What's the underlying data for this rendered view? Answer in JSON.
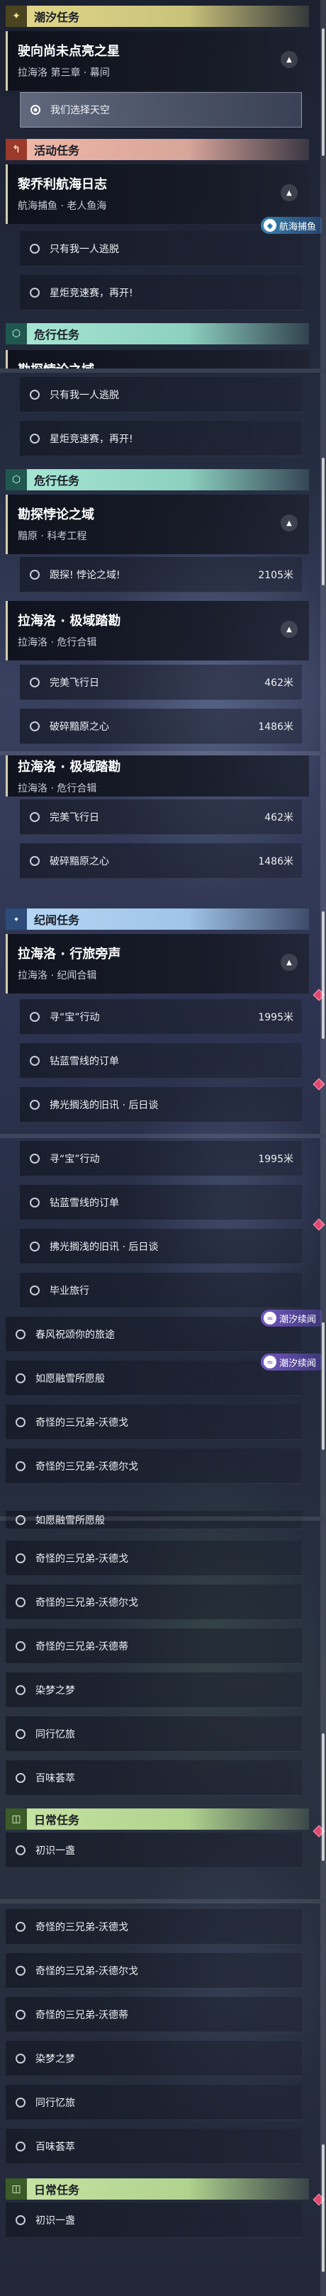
{
  "categories": {
    "sea": {
      "label": "潮汐任务",
      "icon": "✦"
    },
    "activity": {
      "label": "活动任务",
      "icon": "↰"
    },
    "danger": {
      "label": "危行任务",
      "icon": "⬡"
    },
    "record": {
      "label": "纪闻任务",
      "icon": "⬩"
    },
    "daily": {
      "label": "日常任务",
      "icon": "◫"
    }
  },
  "quests": {
    "q1": {
      "title": "驶向尚未点亮之星",
      "subtitle": "拉海洛 第三章 · 幕间"
    },
    "q2": {
      "title": "黎乔利航海日志",
      "subtitle": "航海捕鱼 · 老人鱼海"
    },
    "q3": {
      "title": "勘探悖论之域",
      "subtitle": "黯原 · 科考工程"
    },
    "q4": {
      "title": "拉海洛 · 极域踏勘",
      "subtitle": "拉海洛 · 危行合辑"
    },
    "q5": {
      "title": "拉海洛 · 行旅旁声",
      "subtitle": "拉海洛 · 纪闻合辑"
    }
  },
  "steps": {
    "s_choose": "我们选择天空",
    "s_alone": "只有我一人逃脱",
    "s_torch": "星炬竞速赛，再开!",
    "s_cross": "跟探! 悖论之域!",
    "s_flight": "完美飞行日",
    "s_break": "破碎黯原之心",
    "s_treasure": "寻“宝”行动",
    "s_drill": "钻蓝雪线的订单",
    "s_brush": "拂光搁浅的旧讯 · 后日谈",
    "s_grad": "毕业旅行",
    "s_spring": "春风祝颂你的旅途",
    "s_wish": "如愿融雪所愿般",
    "s_three_ge": "奇怪的三兄弟-沃德戈",
    "s_three_er": "奇怪的三兄弟-沃德尔戈",
    "s_three_di": "奇怪的三兄弟-沃德蒂",
    "s_dream": "染梦之梦",
    "s_memory": "同行忆旅",
    "s_taste": "百味荟萃",
    "s_meet": "初识一盏"
  },
  "distances": {
    "d_cross": "2105米",
    "d_flight": "462米",
    "d_break": "1486米",
    "d_treasure": "1995米"
  },
  "tags": {
    "fishing": "航海捕鱼",
    "tide_story": "潮汐续闻"
  },
  "colors": {
    "sea_accent": "#e2d88b",
    "activity_accent": "#f0b9a8",
    "danger_accent": "#a8e8d4",
    "record_accent": "#b8d8f5",
    "daily_accent": "#c8e4a4",
    "marker": "#e0486e"
  }
}
